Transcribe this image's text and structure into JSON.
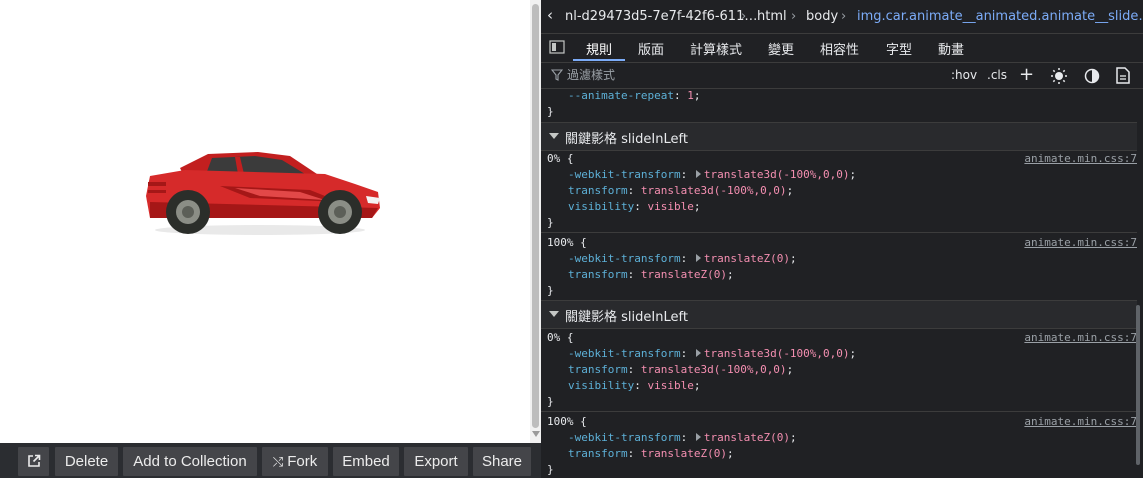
{
  "bottombar": {
    "open_label": "⧉",
    "delete_label": "Delete",
    "add_collection_label": "Add to Collection",
    "fork_label": "Fork",
    "embed_label": "Embed",
    "export_label": "Export",
    "share_label": "Share"
  },
  "devtools": {
    "breadcrumb": {
      "frame": "nl-d29473d5-7e7f-42f6-611…",
      "html": "html",
      "body": "body",
      "element": "img.car.animate__animated.animate__slide…"
    },
    "tabs": [
      "規則",
      "版面",
      "計算樣式",
      "變更",
      "相容性",
      "字型",
      "動畫"
    ],
    "active_tab": "規則",
    "filter_placeholder": "過濾樣式",
    "hov": ":hov",
    "cls": ".cls",
    "top_rule": {
      "prop": "--animate-repeat",
      "val": "1",
      "close": "}"
    },
    "sections": [
      {
        "title": "關鍵影格 slideInLeft",
        "blocks": [
          {
            "selector": "0% {",
            "source": "animate.min.css:7",
            "decls": [
              {
                "prop": "-webkit-transform",
                "val": "translate3d(-100%,0,0)"
              },
              {
                "prop": "transform",
                "val": "translate3d(-100%,0,0)"
              },
              {
                "prop": "visibility",
                "val": "visible"
              }
            ]
          },
          {
            "selector": "100% {",
            "source": "animate.min.css:7",
            "decls": [
              {
                "prop": "-webkit-transform",
                "val": "translateZ(0)"
              },
              {
                "prop": "transform",
                "val": "translateZ(0)"
              }
            ]
          }
        ]
      },
      {
        "title": "關鍵影格 slideInLeft",
        "blocks": [
          {
            "selector": "0% {",
            "source": "animate.min.css:7",
            "decls": [
              {
                "prop": "-webkit-transform",
                "val": "translate3d(-100%,0,0)"
              },
              {
                "prop": "transform",
                "val": "translate3d(-100%,0,0)"
              },
              {
                "prop": "visibility",
                "val": "visible"
              }
            ]
          },
          {
            "selector": "100% {",
            "source": "animate.min.css:7",
            "decls": [
              {
                "prop": "-webkit-transform",
                "val": "translateZ(0)"
              },
              {
                "prop": "transform",
                "val": "translateZ(0)"
              }
            ]
          }
        ]
      }
    ]
  },
  "colors": {
    "car_body": "#d62a2a",
    "devtools_bg": "#202124",
    "property": "#5db0d7",
    "value": "#f29766"
  }
}
